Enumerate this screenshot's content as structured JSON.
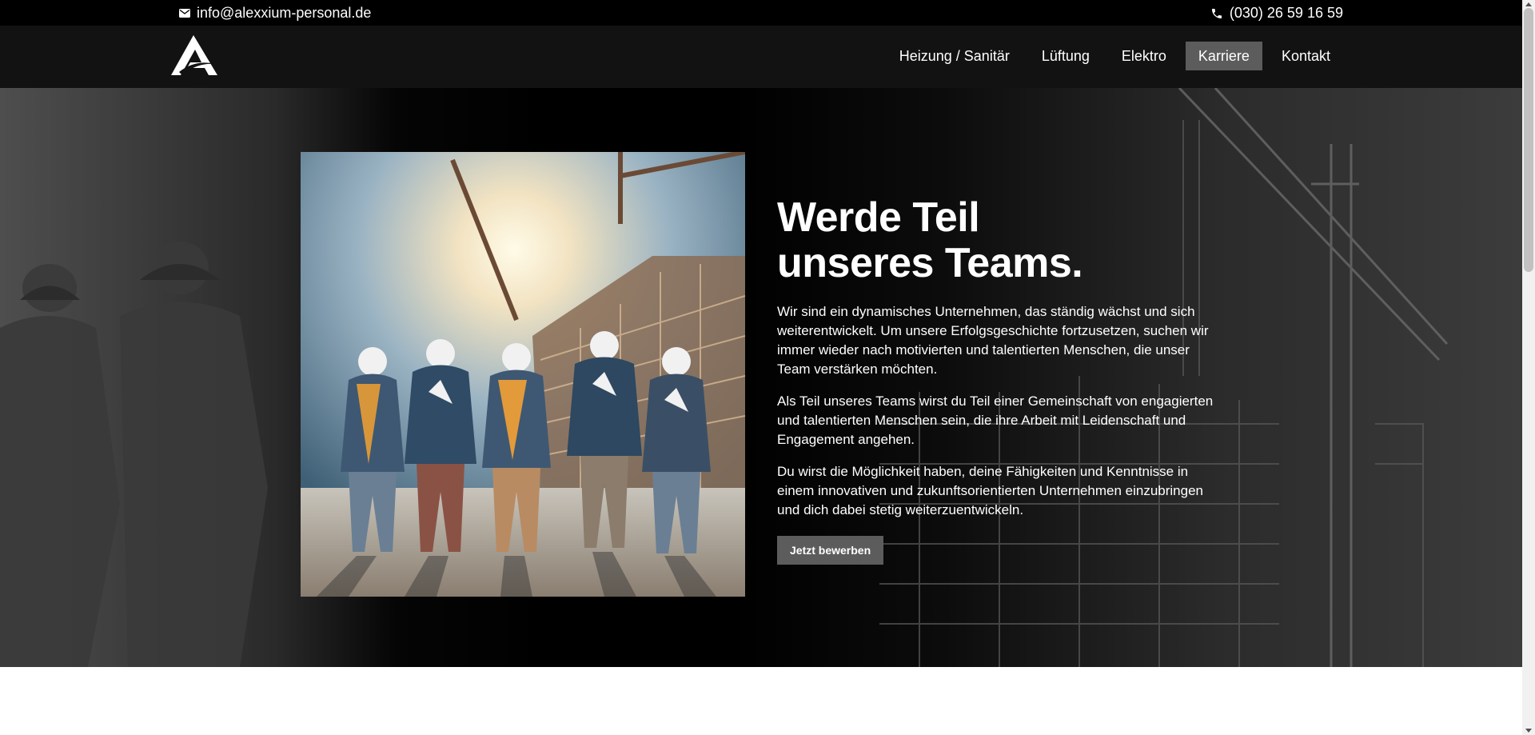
{
  "topbar": {
    "email": "info@alexxium-personal.de",
    "phone": "(030) 26 59 16 59",
    "email_icon": "envelope-icon",
    "phone_icon": "phone-icon"
  },
  "header": {
    "logo_icon": "alexxium-logo-icon",
    "nav": [
      {
        "label": "Heizung / Sanitär",
        "active": false
      },
      {
        "label": "Lüftung",
        "active": false
      },
      {
        "label": "Elektro",
        "active": false
      },
      {
        "label": "Karriere",
        "active": true
      },
      {
        "label": "Kontakt",
        "active": false
      }
    ]
  },
  "hero": {
    "title_line1": "Werde Teil",
    "title_line2": "unseres Teams.",
    "paragraphs": [
      "Wir sind ein dynamisches Unternehmen, das ständig wächst und sich weiterentwickelt. Um unsere Erfolgsgeschichte fortzusetzen, suchen wir immer wieder nach motivierten und talentierten Menschen, die unser Team verstärken möchten.",
      "Als Teil unseres Teams wirst du Teil einer Gemeinschaft von engagierten und talentierten Menschen sein, die ihre Arbeit mit Leidenschaft und Engagement angehen.",
      "Du wirst die Möglichkeit haben, deine Fähigkeiten und Kenntnisse in einem innovativen und zukunftsorientierten Unternehmen einzubringen und dich dabei stetig weiterzuentwickeln."
    ],
    "cta_label": "Jetzt bewerben"
  },
  "colors": {
    "topbar_bg": "#000000",
    "header_bg": "#121212",
    "active_nav_bg": "#5c5c5c",
    "button_bg": "#5c5c5c",
    "text": "#ffffff"
  }
}
